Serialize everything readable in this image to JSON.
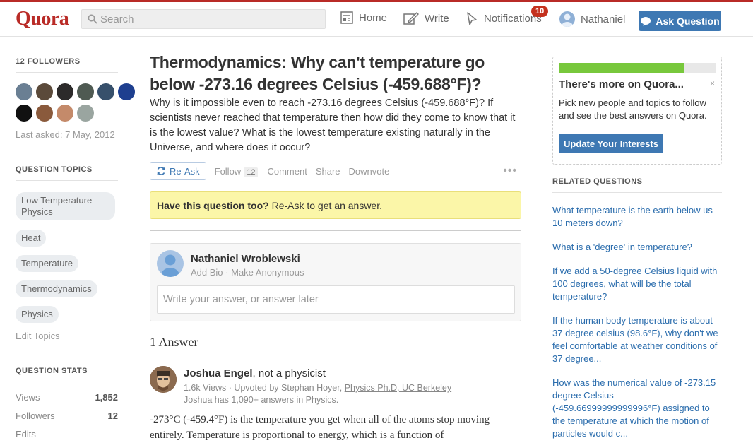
{
  "header": {
    "logo": "Quora",
    "search_placeholder": "Search",
    "nav": {
      "home": "Home",
      "write": "Write",
      "notifications": "Notifications",
      "notifications_count": "10",
      "user": "Nathaniel"
    },
    "ask_button": "Ask Question"
  },
  "left": {
    "followers_title": "12 FOLLOWERS",
    "last_asked": "Last asked: 7 May, 2012",
    "topics_title": "QUESTION TOPICS",
    "topics": [
      "Low Temperature Physics",
      "Heat",
      "Temperature",
      "Thermodynamics",
      "Physics"
    ],
    "edit_topics": "Edit Topics",
    "stats_title": "QUESTION STATS",
    "stats": [
      {
        "label": "Views",
        "value": "1,852"
      },
      {
        "label": "Followers",
        "value": "12"
      },
      {
        "label": "Edits",
        "value": ""
      }
    ]
  },
  "question": {
    "title": "Thermodynamics: Why can't temperature go below -273.16 degrees Celsius (-459.688°F)?",
    "details": "Why is it impossible even to reach -273.16 degrees Celsius (-459.688°F)? If scientists never reached that temperature then how did they come to know that it is the lowest value? What is the lowest temperature existing naturally in the Universe, and where does it occur?",
    "actions": {
      "reask": "Re-Ask",
      "follow": "Follow",
      "follow_count": "12",
      "comment": "Comment",
      "share": "Share",
      "downvote": "Downvote"
    },
    "prompt_bold": "Have this question too?",
    "prompt_rest": " Re-Ask to get an answer."
  },
  "answer_box": {
    "name": "Nathaniel Wroblewski",
    "add_bio": "Add Bio",
    "separator": " · ",
    "make_anon": "Make Anonymous",
    "placeholder": "Write your answer, or answer later"
  },
  "answers": {
    "count_label": "1 Answer",
    "items": [
      {
        "author": "Joshua Engel",
        "credential": ", not a physicist",
        "meta_views": "1.6k Views · Upvoted by Stephan Hoyer, ",
        "meta_link": "Physics Ph.D, UC Berkeley",
        "meta_line2": "Joshua has 1,090+ answers in Physics.",
        "body": "-273°C (-459.4°F) is the temperature you get when all of the atoms stop moving entirely. Temperature is proportional to energy, which is a function of"
      }
    ]
  },
  "right": {
    "promo_title": "There's more on Quora...",
    "promo_text": "Pick new people and topics to follow and see the best answers on Quora.",
    "promo_progress": 0.8,
    "promo_close": "×",
    "promo_button": "Update Your Interests",
    "related_title": "RELATED QUESTIONS",
    "related": [
      "What temperature is the earth below us 10 meters down?",
      "What is a 'degree' in temperature?",
      "If we add a 50-degree Celsius liquid with 100 degrees, what will be the total temperature?",
      "If the human body temperature is about 37 degree celsius (98.6°F), why don't we feel comfortable at weather conditions of 37 degree...",
      "How was the numerical value of -273.15 degree Celsius (-459.66999999999996°F) assigned to the temperature at which the motion of particles would c..."
    ]
  },
  "colors": {
    "brand": "#b92b27",
    "link": "#2b6dad",
    "button": "#3e78b3",
    "progress": "#78c83c"
  }
}
